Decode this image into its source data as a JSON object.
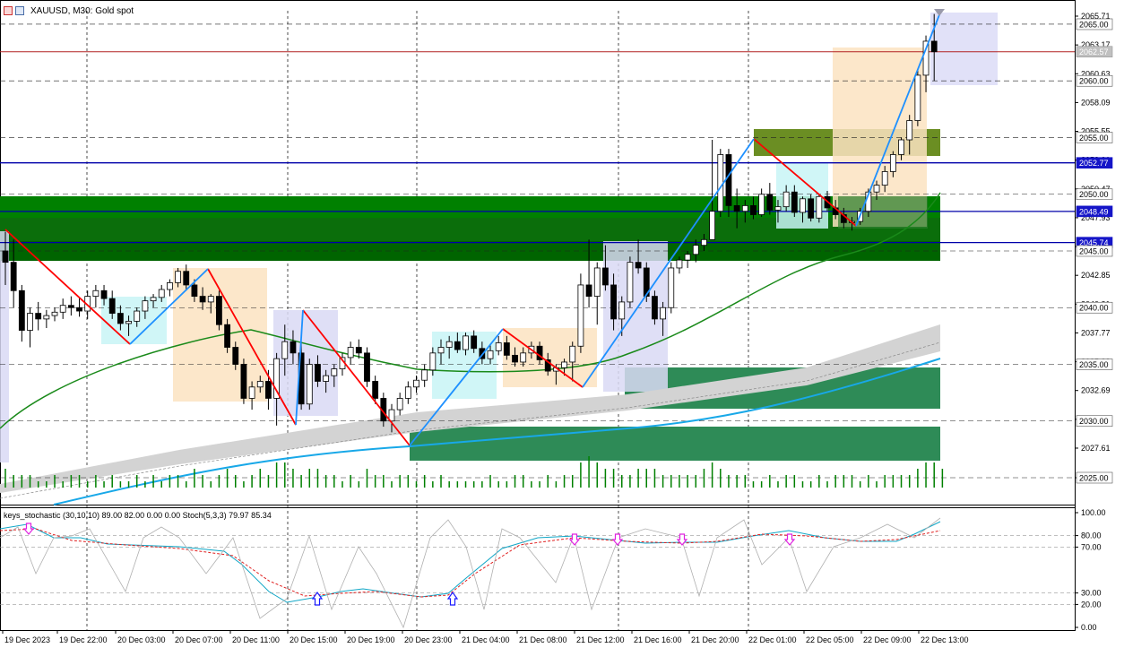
{
  "window": {
    "symbol_title": "XAUUSD, M30:  Gold spot",
    "indicator_title": "keys_stochastic (30,10,10) 89.00 82.00 0.00 0.00 Stoch(5,3,3) 79.97 85.34"
  },
  "icons": [
    "chart-window-icon",
    "bars-icon"
  ],
  "colors": {
    "green_zone": "#007a00",
    "dark_green_zone": "#2e8b57",
    "olive_zone": "#6b8e23",
    "blue_line": "#0000aa",
    "red_line": "#b22222",
    "ma_green": "#1a8a1a",
    "ma_blue": "#18a8e8",
    "zigzag_red": "#ff0000",
    "zigzag_blue": "#1e90ff"
  },
  "price_axis": {
    "tick_labels": [
      "2065.71",
      "2063.17",
      "2060.63",
      "2058.09",
      "2055.55",
      "2053.01",
      "2050.47",
      "2047.93",
      "2045.39",
      "2042.85",
      "2040.31",
      "2037.77",
      "2035.23",
      "2032.69",
      "2030.15",
      "2027.61",
      "2025.00"
    ],
    "badges": [
      {
        "label": "2065.00",
        "kind": "dash"
      },
      {
        "label": "2062.57",
        "kind": "bid"
      },
      {
        "label": "2060.00",
        "kind": "dash"
      },
      {
        "label": "2055.00",
        "kind": "dash"
      },
      {
        "label": "2052.77",
        "kind": "level"
      },
      {
        "label": "2050.00",
        "kind": "dash"
      },
      {
        "label": "2048.49",
        "kind": "level"
      },
      {
        "label": "2045.74",
        "kind": "level"
      },
      {
        "label": "2045.00",
        "kind": "dash"
      },
      {
        "label": "2040.00",
        "kind": "dash"
      },
      {
        "label": "2035.00",
        "kind": "dash"
      },
      {
        "label": "2030.00",
        "kind": "dash"
      },
      {
        "label": "2025.00",
        "kind": "dash"
      }
    ]
  },
  "stoch_axis": {
    "tick_labels": [
      "100.00",
      "80.00",
      "70.00",
      "30.00",
      "20.00",
      "0.00"
    ]
  },
  "time_axis": {
    "labels": [
      "19 Dec 2023",
      "19 Dec 22:00",
      "20 Dec 03:00",
      "20 Dec 07:00",
      "20 Dec 11:00",
      "20 Dec 15:00",
      "20 Dec 19:00",
      "20 Dec 23:00",
      "21 Dec 04:00",
      "21 Dec 08:00",
      "21 Dec 12:00",
      "21 Dec 16:00",
      "21 Dec 20:00",
      "22 Dec 01:00",
      "22 Dec 05:00",
      "22 Dec 09:00",
      "22 Dec 13:00"
    ]
  },
  "chart_data": {
    "type": "candlestick",
    "symbol": "XAUUSD",
    "timeframe": "M30",
    "price_range": [
      2025.0,
      2066.0
    ],
    "current_bid": 2062.57,
    "horizontal_levels": [
      2052.77,
      2048.49,
      2045.74
    ],
    "round_levels": [
      2065.0,
      2060.0,
      2055.0,
      2050.0,
      2045.0,
      2040.0,
      2035.0,
      2030.0,
      2025.0
    ],
    "candles": [
      [
        2045.0,
        2046.7,
        2042.0,
        2044.0
      ],
      [
        2044.0,
        2046.0,
        2040.0,
        2041.5
      ],
      [
        2041.5,
        2042.0,
        2037.0,
        2038.0
      ],
      [
        2038.0,
        2040.0,
        2036.5,
        2039.5
      ],
      [
        2039.5,
        2040.5,
        2038.0,
        2039.0
      ],
      [
        2039.0,
        2039.8,
        2038.2,
        2039.3
      ],
      [
        2039.3,
        2040.0,
        2038.8,
        2039.6
      ],
      [
        2039.6,
        2040.8,
        2039.0,
        2040.2
      ],
      [
        2040.2,
        2041.0,
        2039.3,
        2040.0
      ],
      [
        2040.0,
        2040.9,
        2039.2,
        2039.7
      ],
      [
        2039.7,
        2041.5,
        2039.0,
        2041.0
      ],
      [
        2041.0,
        2042.0,
        2040.0,
        2041.5
      ],
      [
        2041.5,
        2042.0,
        2040.2,
        2040.8
      ],
      [
        2040.8,
        2041.5,
        2039.0,
        2039.5
      ],
      [
        2039.5,
        2040.2,
        2038.0,
        2038.6
      ],
      [
        2038.6,
        2039.3,
        2037.5,
        2038.8
      ],
      [
        2038.8,
        2040.0,
        2038.3,
        2039.7
      ],
      [
        2039.7,
        2041.0,
        2039.0,
        2040.6
      ],
      [
        2040.6,
        2041.2,
        2040.0,
        2040.9
      ],
      [
        2040.9,
        2042.0,
        2040.5,
        2041.6
      ],
      [
        2041.6,
        2042.5,
        2041.0,
        2042.2
      ],
      [
        2042.2,
        2043.5,
        2041.8,
        2043.2
      ],
      [
        2043.2,
        2043.8,
        2041.5,
        2042.0
      ],
      [
        2042.0,
        2042.5,
        2040.5,
        2041.0
      ],
      [
        2041.0,
        2041.8,
        2039.8,
        2040.5
      ],
      [
        2040.5,
        2041.2,
        2039.5,
        2041.0
      ],
      [
        2041.0,
        2041.5,
        2038.0,
        2038.5
      ],
      [
        2038.5,
        2039.0,
        2036.0,
        2036.5
      ],
      [
        2036.5,
        2037.0,
        2034.5,
        2035.0
      ],
      [
        2035.0,
        2035.5,
        2031.5,
        2032.0
      ],
      [
        2032.0,
        2033.5,
        2031.0,
        2033.0
      ],
      [
        2033.0,
        2034.0,
        2032.5,
        2033.5
      ],
      [
        2033.5,
        2034.5,
        2031.0,
        2032.0
      ],
      [
        2032.0,
        2036.0,
        2029.6,
        2035.5
      ],
      [
        2035.5,
        2038.5,
        2034.0,
        2037.0
      ],
      [
        2037.0,
        2038.0,
        2035.0,
        2036.0
      ],
      [
        2036.0,
        2037.0,
        2031.0,
        2031.5
      ],
      [
        2031.5,
        2035.5,
        2031.0,
        2035.0
      ],
      [
        2035.0,
        2035.8,
        2033.0,
        2033.5
      ],
      [
        2033.5,
        2034.5,
        2032.5,
        2034.0
      ],
      [
        2034.0,
        2035.0,
        2033.0,
        2034.6
      ],
      [
        2034.6,
        2036.0,
        2034.0,
        2035.6
      ],
      [
        2035.6,
        2037.0,
        2035.0,
        2036.5
      ],
      [
        2036.5,
        2037.2,
        2035.5,
        2036.0
      ],
      [
        2036.0,
        2036.5,
        2033.0,
        2033.5
      ],
      [
        2033.5,
        2034.0,
        2031.5,
        2032.0
      ],
      [
        2032.0,
        2032.5,
        2029.5,
        2030.0
      ],
      [
        2030.0,
        2031.5,
        2029.0,
        2031.0
      ],
      [
        2031.0,
        2032.5,
        2030.5,
        2032.0
      ],
      [
        2032.0,
        2033.5,
        2031.5,
        2033.0
      ],
      [
        2033.0,
        2034.0,
        2032.5,
        2033.6
      ],
      [
        2033.6,
        2035.0,
        2033.0,
        2034.5
      ],
      [
        2034.5,
        2036.5,
        2034.0,
        2036.0
      ],
      [
        2036.0,
        2037.2,
        2035.0,
        2036.5
      ],
      [
        2036.5,
        2037.5,
        2035.5,
        2037.0
      ],
      [
        2037.0,
        2037.8,
        2036.0,
        2036.3
      ],
      [
        2036.3,
        2037.8,
        2035.8,
        2037.5
      ],
      [
        2037.5,
        2038.0,
        2036.0,
        2036.4
      ],
      [
        2036.4,
        2037.0,
        2035.0,
        2035.5
      ],
      [
        2035.5,
        2036.8,
        2035.0,
        2036.2
      ],
      [
        2036.2,
        2037.5,
        2035.8,
        2036.9
      ],
      [
        2036.9,
        2037.5,
        2035.4,
        2035.8
      ],
      [
        2035.8,
        2036.5,
        2034.8,
        2035.2
      ],
      [
        2035.2,
        2036.5,
        2034.8,
        2036.0
      ],
      [
        2036.0,
        2037.0,
        2035.5,
        2036.6
      ],
      [
        2036.6,
        2037.0,
        2035.0,
        2035.4
      ],
      [
        2035.4,
        2036.0,
        2034.0,
        2034.4
      ],
      [
        2034.4,
        2035.0,
        2033.2,
        2034.7
      ],
      [
        2034.7,
        2035.5,
        2034.0,
        2035.2
      ],
      [
        2035.2,
        2037.0,
        2033.5,
        2036.6
      ],
      [
        2036.6,
        2043.0,
        2036.0,
        2042.0
      ],
      [
        2042.0,
        2046.0,
        2040.0,
        2041.0
      ],
      [
        2041.0,
        2044.0,
        2038.5,
        2043.5
      ],
      [
        2043.5,
        2045.5,
        2041.5,
        2042.0
      ],
      [
        2042.0,
        2043.0,
        2038.0,
        2039.0
      ],
      [
        2039.0,
        2041.0,
        2037.5,
        2040.5
      ],
      [
        2040.5,
        2044.5,
        2040.0,
        2044.0
      ],
      [
        2044.0,
        2046.0,
        2043.0,
        2043.5
      ],
      [
        2043.5,
        2044.0,
        2040.5,
        2041.0
      ],
      [
        2041.0,
        2041.5,
        2038.5,
        2039.0
      ],
      [
        2039.0,
        2040.5,
        2037.5,
        2040.0
      ],
      [
        2040.0,
        2044.0,
        2039.5,
        2043.5
      ],
      [
        2043.5,
        2044.5,
        2043.0,
        2044.2
      ],
      [
        2044.2,
        2045.0,
        2043.5,
        2044.7
      ],
      [
        2044.7,
        2046.0,
        2044.0,
        2045.5
      ],
      [
        2045.5,
        2046.5,
        2045.0,
        2046.0
      ],
      [
        2046.0,
        2054.8,
        2046.0,
        2048.5
      ],
      [
        2048.5,
        2054.0,
        2048.0,
        2053.5
      ],
      [
        2053.5,
        2054.0,
        2048.0,
        2049.0
      ],
      [
        2049.0,
        2050.5,
        2047.0,
        2048.5
      ],
      [
        2048.5,
        2049.5,
        2047.5,
        2049.0
      ],
      [
        2049.0,
        2049.8,
        2047.8,
        2048.2
      ],
      [
        2048.2,
        2050.5,
        2048.0,
        2050.0
      ],
      [
        2050.0,
        2051.0,
        2048.2,
        2048.6
      ],
      [
        2048.6,
        2049.5,
        2047.5,
        2048.9
      ],
      [
        2048.9,
        2050.8,
        2048.5,
        2050.2
      ],
      [
        2050.2,
        2050.8,
        2048.0,
        2048.4
      ],
      [
        2048.4,
        2049.8,
        2047.5,
        2049.6
      ],
      [
        2049.6,
        2050.0,
        2047.6,
        2047.9
      ],
      [
        2047.9,
        2050.0,
        2047.5,
        2049.8
      ],
      [
        2049.8,
        2050.3,
        2048.5,
        2048.8
      ],
      [
        2048.8,
        2049.5,
        2047.8,
        2048.2
      ],
      [
        2048.2,
        2048.8,
        2047.0,
        2047.5
      ],
      [
        2047.5,
        2048.0,
        2046.8,
        2047.6
      ],
      [
        2047.6,
        2048.8,
        2047.3,
        2048.5
      ],
      [
        2048.5,
        2050.5,
        2048.0,
        2050.2
      ],
      [
        2050.2,
        2051.2,
        2049.5,
        2050.8
      ],
      [
        2050.8,
        2052.5,
        2050.2,
        2052.0
      ],
      [
        2052.0,
        2053.8,
        2051.5,
        2053.5
      ],
      [
        2053.5,
        2055.0,
        2053.0,
        2054.8
      ],
      [
        2054.8,
        2057.0,
        2053.5,
        2056.5
      ],
      [
        2056.5,
        2061.0,
        2056.0,
        2060.5
      ],
      [
        2060.5,
        2064.0,
        2059.0,
        2063.5
      ],
      [
        2063.5,
        2065.9,
        2060.0,
        2062.57
      ]
    ],
    "volume_relative": [
      3,
      2,
      2,
      2,
      1,
      1,
      2,
      1,
      2,
      2,
      1,
      2,
      1,
      2,
      1,
      1,
      2,
      1,
      2,
      1,
      2,
      2,
      1,
      3,
      2,
      1,
      2,
      3,
      2,
      1,
      2,
      3,
      2,
      4,
      4,
      3,
      2,
      3,
      3,
      2,
      2,
      1,
      2,
      1,
      3,
      2,
      2,
      1,
      2,
      2,
      1,
      2,
      1,
      2,
      1,
      1,
      1,
      1,
      1,
      2,
      1,
      1,
      2,
      2,
      1,
      1,
      2,
      1,
      2,
      2,
      4,
      5,
      4,
      3,
      3,
      2,
      2,
      3,
      3,
      3,
      2,
      2,
      2,
      2,
      2,
      3,
      4,
      3,
      2,
      2,
      2,
      1,
      1,
      2,
      1,
      2,
      2,
      1,
      1,
      2,
      1,
      2,
      2,
      2,
      1,
      2,
      1,
      2,
      2,
      2,
      2,
      3,
      4,
      4,
      3
    ]
  },
  "annotations": {
    "arrows_up": [
      {
        "x": "20 Dec 15:00"
      },
      {
        "x": "21 Dec 04:00"
      }
    ],
    "arrows_down": [
      {
        "x": "19 Dec 2023"
      },
      {
        "x": "21 Dec 09:00"
      },
      {
        "x": "21 Dec 12:00"
      },
      {
        "x": "21 Dec 15:00"
      },
      {
        "x": "22 Dec 02:30"
      }
    ]
  }
}
